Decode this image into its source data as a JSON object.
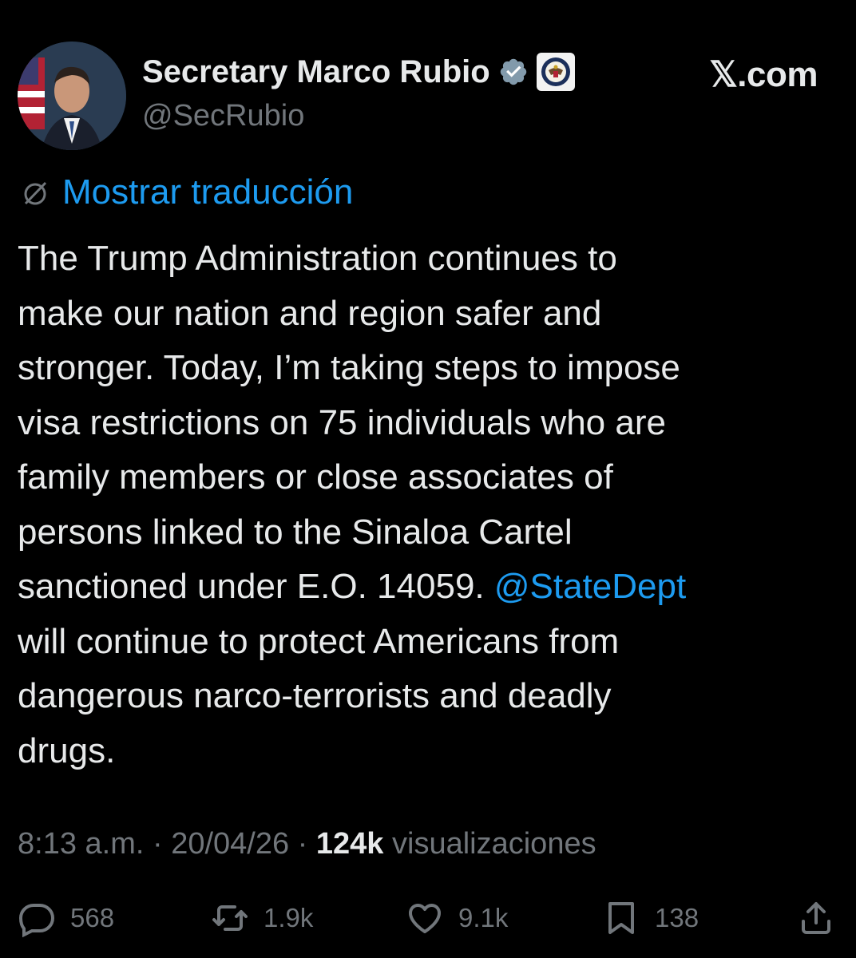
{
  "author": {
    "name": "Secretary Marco Rubio",
    "handle": "@SecRubio",
    "verified_icon": "verified-badge-icon",
    "affiliate_icon": "state-department-seal-icon"
  },
  "source": "𝕏.com",
  "translate_link": "Mostrar traducción",
  "tweet": {
    "text_before": "The Trump Administration continues to\nmake our nation and region safer and\nstronger. Today, I’m taking steps to impose\nvisa restrictions on 75 individuals who are\nfamily members or close associates of\npersons linked to the Sinaloa Cartel\nsanctioned under E.O. 14059. ",
    "mention": "@StateDept",
    "text_after": "\nwill continue to protect Americans from\ndangerous narco-terrorists and deadly\ndrugs."
  },
  "meta": {
    "time": "8:13 a.m.",
    "sep1": " · ",
    "date": "20/04/26",
    "sep2": " · ",
    "views_count": "124k",
    "views_label": " visualizaciones"
  },
  "actions": {
    "replies": "568",
    "reposts": "1.9k",
    "likes": "9.1k",
    "bookmarks": "138"
  },
  "colors": {
    "background": "#000000",
    "text": "#e7e9ea",
    "secondary": "#71767b",
    "accent": "#1d9bf0"
  }
}
